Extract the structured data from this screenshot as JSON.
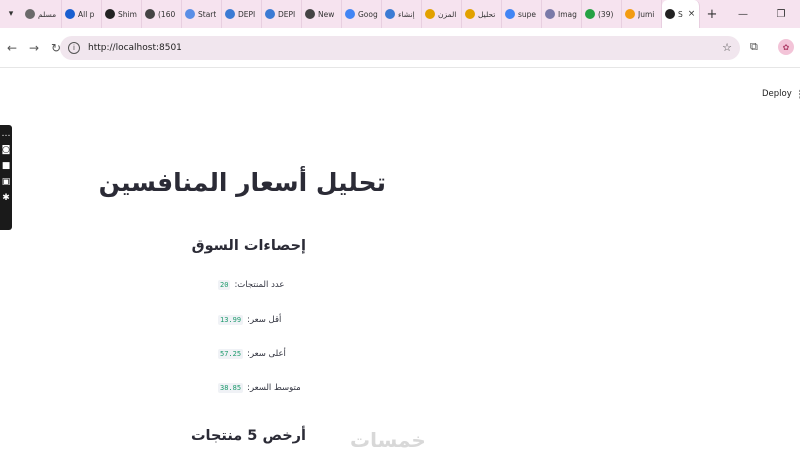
{
  "browser": {
    "tabs": [
      {
        "title": "مسلم",
        "color": "#6a6a6a"
      },
      {
        "title": "All p",
        "color": "#1a5fd0"
      },
      {
        "title": "Shim",
        "color": "#222222"
      },
      {
        "title": "(160",
        "color": "#444444"
      },
      {
        "title": "Start",
        "color": "#5a8ee6"
      },
      {
        "title": "DEPI",
        "color": "#3b7bd4"
      },
      {
        "title": "DEPI",
        "color": "#3b7bd4"
      },
      {
        "title": "New",
        "color": "#444444"
      },
      {
        "title": "Goog",
        "color": "#4285f4"
      },
      {
        "title": "إنشاء",
        "color": "#3b7bd4"
      },
      {
        "title": "المزن",
        "color": "#e2a100"
      },
      {
        "title": "تحليل",
        "color": "#e2a100"
      },
      {
        "title": "supe",
        "color": "#4285f4"
      },
      {
        "title": "Imag",
        "color": "#7a7aa8"
      },
      {
        "title": "(39)",
        "color": "#25a244"
      },
      {
        "title": "Jumi",
        "color": "#f39c12"
      },
      {
        "title": "S",
        "color": "#222222",
        "active": true
      }
    ],
    "new_tab": "+",
    "tab_close": "×",
    "window_minimize": "—",
    "window_restore": "❐",
    "url": "http://localhost:8501",
    "profile_initial": "✿"
  },
  "app": {
    "deploy_label": "Deploy",
    "title": "تحليل أسعار المنافسين",
    "market_stats_heading": "إحصاءات السوق",
    "stats": [
      {
        "label": "عدد المنتجات:",
        "value": "20"
      },
      {
        "label": "أقل سعر:",
        "value": "13.99"
      },
      {
        "label": "أعلى سعر:",
        "value": "57.25"
      },
      {
        "label": "متوسط السعر:",
        "value": "38.85"
      }
    ],
    "cheapest_heading": "أرخص 5 منتجات"
  },
  "watermark": "خمسات"
}
